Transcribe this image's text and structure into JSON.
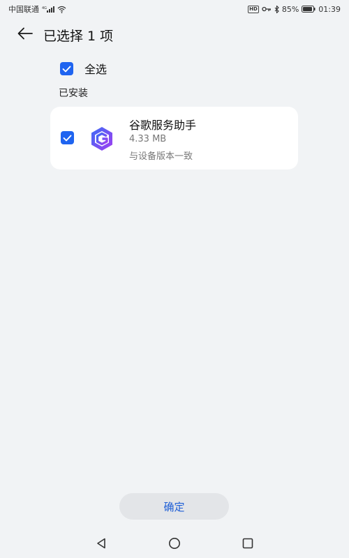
{
  "status_bar": {
    "carrier": "中国联通",
    "signal_label": "4G",
    "battery_percent": "85%",
    "time": "01:39"
  },
  "header": {
    "title": "已选择 1 项"
  },
  "select_all": {
    "label": "全选",
    "checked": true
  },
  "section": {
    "title": "已安装"
  },
  "apps": [
    {
      "name": "谷歌服务助手",
      "size": "4.33 MB",
      "version_status": "与设备版本一致",
      "checked": true,
      "icon": "google-services-icon"
    }
  ],
  "confirm_button": {
    "label": "确定"
  },
  "colors": {
    "accent": "#1f64f0",
    "background": "#f1f3f5",
    "card": "#ffffff",
    "button_bg": "#e3e5e8",
    "button_text": "#1f5fd6"
  }
}
